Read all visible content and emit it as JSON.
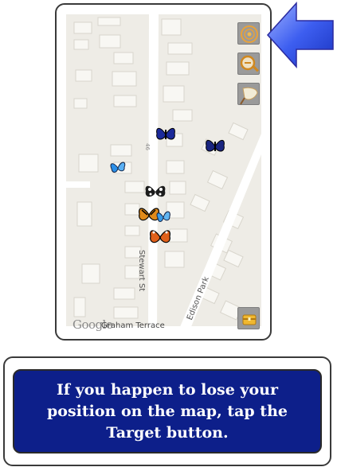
{
  "map": {
    "street_labels": {
      "stewart": "Stewart St",
      "edison": "Edison Park",
      "graham": "Graham Terrace",
      "number": "46"
    },
    "attribution": "Google",
    "colors": {
      "land": "#eeece6",
      "building": "#f8f7f3",
      "road": "#ffffff"
    }
  },
  "controls": [
    {
      "name": "target-button",
      "icon": "target-icon"
    },
    {
      "name": "zoom-button",
      "icon": "magnifier-icon"
    },
    {
      "name": "net-button",
      "icon": "butterfly-net-icon"
    },
    {
      "name": "collection-button",
      "icon": "treasure-chest-icon"
    }
  ],
  "butterflies": [
    {
      "name": "blue-swallowtail",
      "color": "#1b2a9a"
    },
    {
      "name": "dark-blue",
      "color": "#1a2580"
    },
    {
      "name": "light-blue",
      "color": "#2b8fe8"
    },
    {
      "name": "black-white",
      "color": "#1c1c1c"
    },
    {
      "name": "tiger",
      "color": "#e08a1a"
    },
    {
      "name": "blue-small",
      "color": "#3a9be6"
    },
    {
      "name": "orange",
      "color": "#e0601a"
    }
  ],
  "pointer": {
    "icon": "blue-arrow-icon",
    "color": "#2a4fe0"
  },
  "caption": {
    "text": "If you happen to lose your position on the map, tap the Target button."
  }
}
